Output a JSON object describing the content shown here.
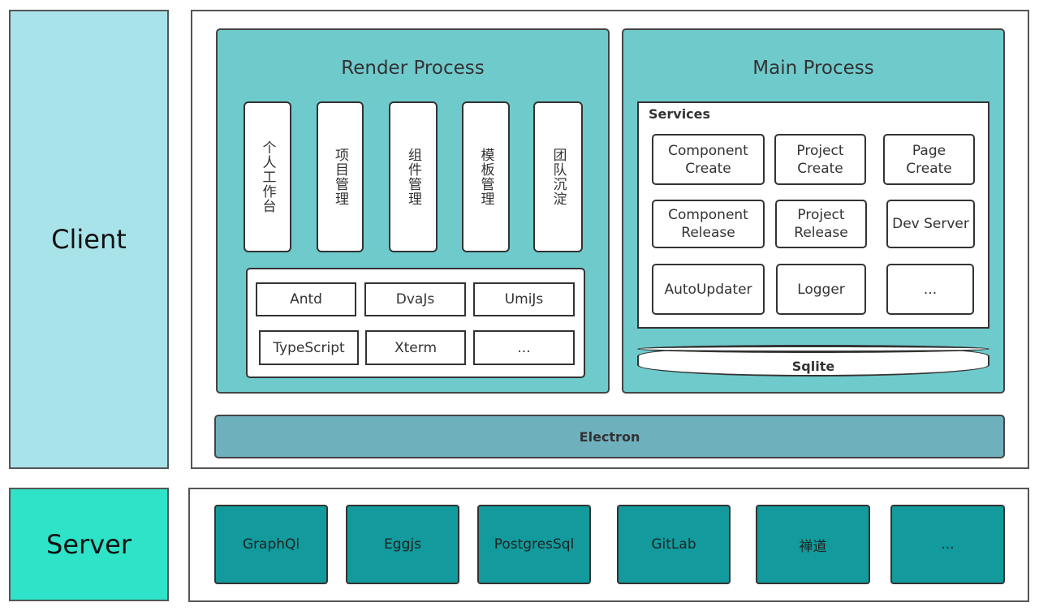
{
  "colors": {
    "client": "#a9e3ea",
    "server": "#2ee3c8",
    "panel": "#6fcacc",
    "electron": "#6fb0bd",
    "server_item": "#129a9c"
  },
  "client_label": "Client",
  "server_label": "Server",
  "render": {
    "title": "Render Process",
    "modules": [
      "个人工作台",
      "项目管理",
      "组件管理",
      "模板管理",
      "团队沉淀"
    ],
    "libs": [
      "Antd",
      "DvaJs",
      "UmiJs",
      "TypeScript",
      "Xterm",
      "..."
    ]
  },
  "main": {
    "title": "Main Process",
    "services_label": "Services",
    "services": [
      "Component Create",
      "Project Create",
      "Page Create",
      "Component Release",
      "Project Release",
      "Dev Server",
      "AutoUpdater",
      "Logger",
      "..."
    ],
    "db": "Sqlite"
  },
  "electron": "Electron",
  "server_items": [
    "GraphQl",
    "Eggjs",
    "PostgresSql",
    "GitLab",
    "禅道",
    "..."
  ]
}
